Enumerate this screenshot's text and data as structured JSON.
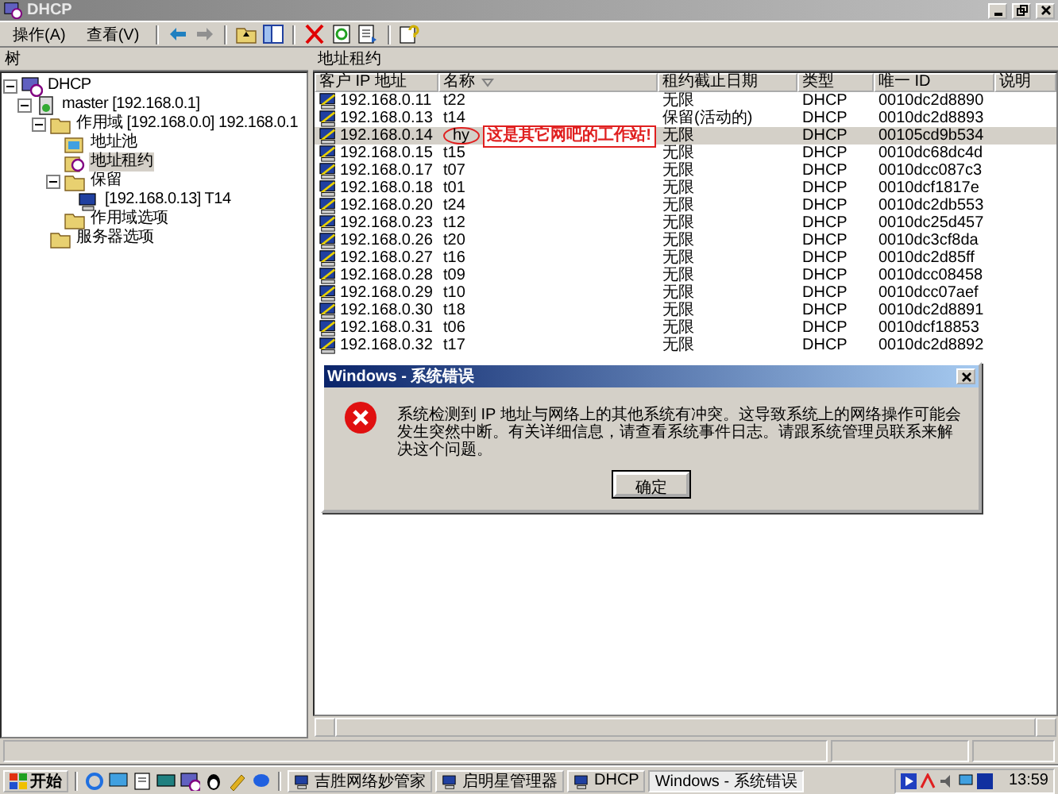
{
  "window": {
    "title": "DHCP"
  },
  "menu": [
    "操作(A)",
    "查看(V)"
  ],
  "left_pane": {
    "tab": "树",
    "tree": [
      {
        "label": "DHCP",
        "kind": "root",
        "selected": false,
        "expanded": true,
        "children": [
          {
            "label": "master [192.168.0.1]",
            "kind": "server",
            "selected": false,
            "expanded": true,
            "children": [
              {
                "label": "作用域 [192.168.0.0] 192.168.0.1",
                "kind": "folder",
                "selected": false,
                "expanded": true,
                "children": [
                  {
                    "label": "地址池",
                    "kind": "pool",
                    "selected": false
                  },
                  {
                    "label": "地址租约",
                    "kind": "lease",
                    "selected": true
                  },
                  {
                    "label": "保留",
                    "kind": "folder",
                    "selected": false,
                    "expanded": true,
                    "children": [
                      {
                        "label": "[192.168.0.13] T14",
                        "kind": "pc",
                        "selected": false
                      }
                    ]
                  },
                  {
                    "label": "作用域选项",
                    "kind": "folder",
                    "selected": false
                  }
                ]
              },
              {
                "label": "服务器选项",
                "kind": "folder",
                "selected": false
              }
            ]
          }
        ]
      }
    ]
  },
  "right_pane": {
    "title": "地址租约",
    "columns": [
      {
        "label": "客户 IP 地址",
        "sorted": false
      },
      {
        "label": "名称",
        "sorted": true
      },
      {
        "label": "租约截止日期",
        "sorted": false
      },
      {
        "label": "类型",
        "sorted": false
      },
      {
        "label": "唯一 ID",
        "sorted": false
      },
      {
        "label": "说明",
        "sorted": false
      }
    ],
    "rows": [
      {
        "ip": "192.168.0.11",
        "name": "t22",
        "expiry": "无限",
        "type": "DHCP",
        "uid": "0010dc2d8890",
        "selected": false
      },
      {
        "ip": "192.168.0.13",
        "name": "t14",
        "expiry": "保留(活动的)",
        "type": "DHCP",
        "uid": "0010dc2d8893",
        "selected": false
      },
      {
        "ip": "192.168.0.14",
        "name": "hy",
        "expiry": "无限",
        "type": "DHCP",
        "uid": "00105cd9b534",
        "selected": true,
        "annotation": "这是其它网吧的工作站!"
      },
      {
        "ip": "192.168.0.15",
        "name": "t15",
        "expiry": "无限",
        "type": "DHCP",
        "uid": "0010dc68dc4d",
        "selected": false
      },
      {
        "ip": "192.168.0.17",
        "name": "t07",
        "expiry": "无限",
        "type": "DHCP",
        "uid": "0010dcc087c3",
        "selected": false
      },
      {
        "ip": "192.168.0.18",
        "name": "t01",
        "expiry": "无限",
        "type": "DHCP",
        "uid": "0010dcf1817e",
        "selected": false
      },
      {
        "ip": "192.168.0.20",
        "name": "t24",
        "expiry": "无限",
        "type": "DHCP",
        "uid": "0010dc2db553",
        "selected": false
      },
      {
        "ip": "192.168.0.23",
        "name": "t12",
        "expiry": "无限",
        "type": "DHCP",
        "uid": "0010dc25d457",
        "selected": false
      },
      {
        "ip": "192.168.0.26",
        "name": "t20",
        "expiry": "无限",
        "type": "DHCP",
        "uid": "0010dc3cf8da",
        "selected": false
      },
      {
        "ip": "192.168.0.27",
        "name": "t16",
        "expiry": "无限",
        "type": "DHCP",
        "uid": "0010dc2d85ff",
        "selected": false
      },
      {
        "ip": "192.168.0.28",
        "name": "t09",
        "expiry": "无限",
        "type": "DHCP",
        "uid": "0010dcc08458",
        "selected": false
      },
      {
        "ip": "192.168.0.29",
        "name": "t10",
        "expiry": "无限",
        "type": "DHCP",
        "uid": "0010dcc07aef",
        "selected": false
      },
      {
        "ip": "192.168.0.30",
        "name": "t18",
        "expiry": "无限",
        "type": "DHCP",
        "uid": "0010dc2d8891",
        "selected": false
      },
      {
        "ip": "192.168.0.31",
        "name": "t06",
        "expiry": "无限",
        "type": "DHCP",
        "uid": "0010dcf18853",
        "selected": false
      },
      {
        "ip": "192.168.0.32",
        "name": "t17",
        "expiry": "无限",
        "type": "DHCP",
        "uid": "0010dc2d8892",
        "selected": false
      }
    ]
  },
  "dialog": {
    "title": "Windows - 系统错误",
    "message": "系统检测到 IP 地址与网络上的其他系统有冲突。这导致系统上的网络操作可能会发生突然中断。有关详细信息，请查看系统事件日志。请跟系统管理员联系来解决这个问题。",
    "button": "确定"
  },
  "taskbar": {
    "start": "开始",
    "tasks": [
      {
        "label": "吉胜网络妙管家",
        "selected": false
      },
      {
        "label": "启明星管理器",
        "selected": false
      },
      {
        "label": "DHCP",
        "selected": false
      },
      {
        "label": "Windows - 系统错误",
        "selected": true
      }
    ],
    "clock": "13:59"
  }
}
